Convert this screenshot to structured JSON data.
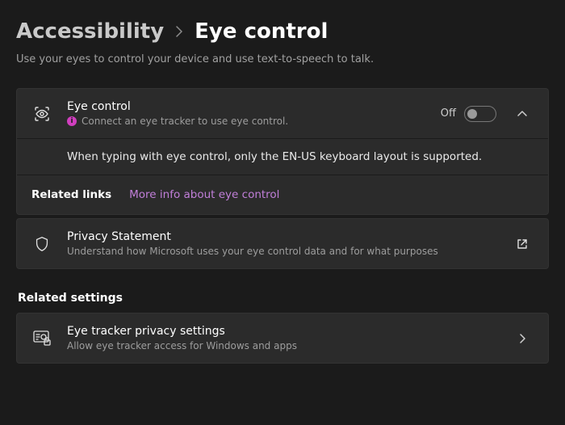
{
  "breadcrumb": {
    "parent": "Accessibility",
    "current": "Eye control"
  },
  "subtitle": "Use your eyes to control your device and use text-to-speech to talk.",
  "eye_control": {
    "title": "Eye control",
    "hint": "Connect an eye tracker to use eye control.",
    "toggle_label": "Off",
    "note": "When typing with eye control, only the EN-US keyboard layout is supported."
  },
  "related_links": {
    "label": "Related links",
    "more_info": "More info about eye control"
  },
  "privacy": {
    "title": "Privacy Statement",
    "desc": "Understand how Microsoft uses your eye control data and for what purposes"
  },
  "related_settings": {
    "header": "Related settings",
    "item": {
      "title": "Eye tracker privacy settings",
      "desc": "Allow eye tracker access for Windows and apps"
    }
  }
}
